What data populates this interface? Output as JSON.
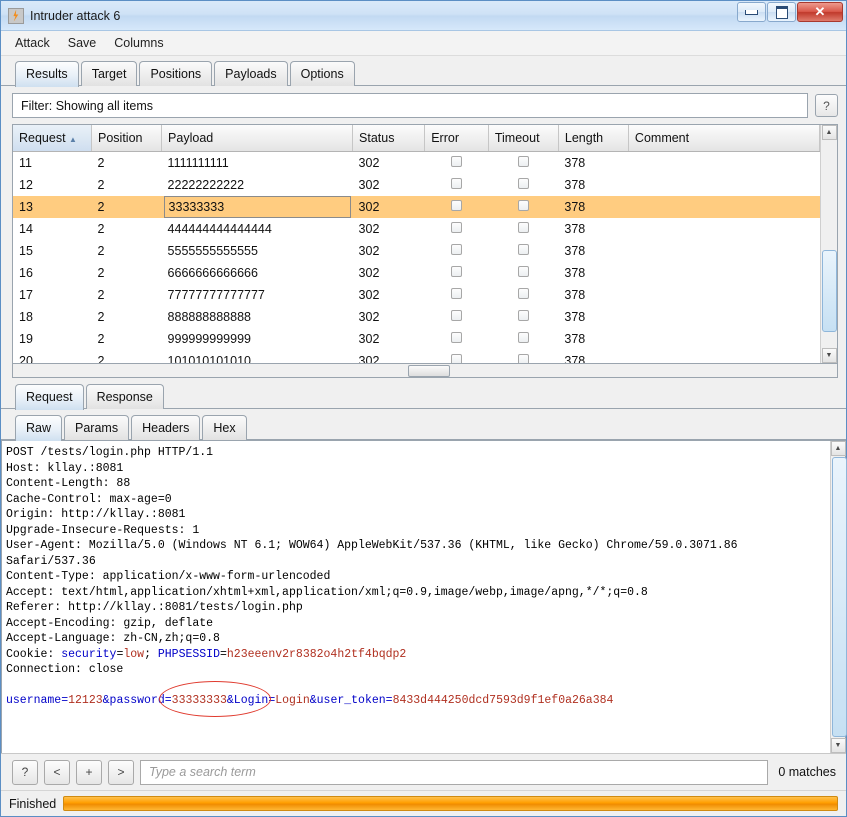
{
  "window": {
    "title": "Intruder attack 6",
    "icon": "burp-icon",
    "controls": {
      "minimize": "minimize",
      "maximize": "maximize",
      "close": "close"
    }
  },
  "menu": {
    "items": [
      "Attack",
      "Save",
      "Columns"
    ]
  },
  "tabs": {
    "items": [
      "Results",
      "Target",
      "Positions",
      "Payloads",
      "Options"
    ],
    "active": "Results"
  },
  "filter": {
    "label": "Filter: Showing all items",
    "help": "?"
  },
  "results_table": {
    "columns": [
      "Request",
      "Position",
      "Payload",
      "Status",
      "Error",
      "Timeout",
      "Length",
      "Comment"
    ],
    "sort_column": "Request",
    "sort_direction": "ascending",
    "selected_row_index": 2,
    "rows": [
      {
        "request": "11",
        "position": "2",
        "payload": "1111111111",
        "status": "302",
        "error": false,
        "timeout": false,
        "length": "378",
        "comment": ""
      },
      {
        "request": "12",
        "position": "2",
        "payload": "22222222222",
        "status": "302",
        "error": false,
        "timeout": false,
        "length": "378",
        "comment": ""
      },
      {
        "request": "13",
        "position": "2",
        "payload": "33333333",
        "status": "302",
        "error": false,
        "timeout": false,
        "length": "378",
        "comment": ""
      },
      {
        "request": "14",
        "position": "2",
        "payload": "444444444444444",
        "status": "302",
        "error": false,
        "timeout": false,
        "length": "378",
        "comment": ""
      },
      {
        "request": "15",
        "position": "2",
        "payload": "5555555555555",
        "status": "302",
        "error": false,
        "timeout": false,
        "length": "378",
        "comment": ""
      },
      {
        "request": "16",
        "position": "2",
        "payload": "6666666666666",
        "status": "302",
        "error": false,
        "timeout": false,
        "length": "378",
        "comment": ""
      },
      {
        "request": "17",
        "position": "2",
        "payload": "77777777777777",
        "status": "302",
        "error": false,
        "timeout": false,
        "length": "378",
        "comment": ""
      },
      {
        "request": "18",
        "position": "2",
        "payload": "888888888888",
        "status": "302",
        "error": false,
        "timeout": false,
        "length": "378",
        "comment": ""
      },
      {
        "request": "19",
        "position": "2",
        "payload": "999999999999",
        "status": "302",
        "error": false,
        "timeout": false,
        "length": "378",
        "comment": ""
      },
      {
        "request": "20",
        "position": "2",
        "payload": "101010101010",
        "status": "302",
        "error": false,
        "timeout": false,
        "length": "378",
        "comment": ""
      }
    ]
  },
  "message_tabs": {
    "items": [
      "Request",
      "Response"
    ],
    "active": "Request"
  },
  "view_tabs": {
    "items": [
      "Raw",
      "Params",
      "Headers",
      "Hex"
    ],
    "active": "Raw"
  },
  "request_raw": {
    "lines": [
      "POST /tests/login.php HTTP/1.1",
      "Host: kllay.:8081",
      "Content-Length: 88",
      "Cache-Control: max-age=0",
      "Origin: http://kllay.:8081",
      "Upgrade-Insecure-Requests: 1",
      "User-Agent: Mozilla/5.0 (Windows NT 6.1; WOW64) AppleWebKit/537.36 (KHTML, like Gecko) Chrome/59.0.3071.86",
      "Safari/537.36",
      "Content-Type: application/x-www-form-urlencoded",
      "Accept: text/html,application/xhtml+xml,application/xml;q=0.9,image/webp,image/apng,*/*;q=0.8",
      "Referer: http://kllay.:8081/tests/login.php",
      "Accept-Encoding: gzip, deflate",
      "Accept-Language: zh-CN,zh;q=0.8"
    ],
    "cookie_line": {
      "prefix": "Cookie: ",
      "name1": "security",
      "eq": "=",
      "value1": "low",
      "sep": "; ",
      "name2": "PHPSESSID",
      "value2": "h23eeenv2r8382o4h2tf4bqdp2"
    },
    "connection_line": "Connection: close",
    "body": "username=12123&password=33333333&Login=Login&user_token=8433d444250dcd7593d9f1ef0a26a384",
    "annotation": {
      "shape": "ellipse",
      "target": "password=33333333",
      "color": "#e03b2f"
    }
  },
  "search": {
    "buttons": [
      "?",
      "<",
      "+",
      ">"
    ],
    "placeholder": "Type a search term",
    "value": "",
    "matches": "0 matches"
  },
  "status": {
    "text": "Finished",
    "progress_percent": 100,
    "progress_color": "#ff9e00"
  }
}
